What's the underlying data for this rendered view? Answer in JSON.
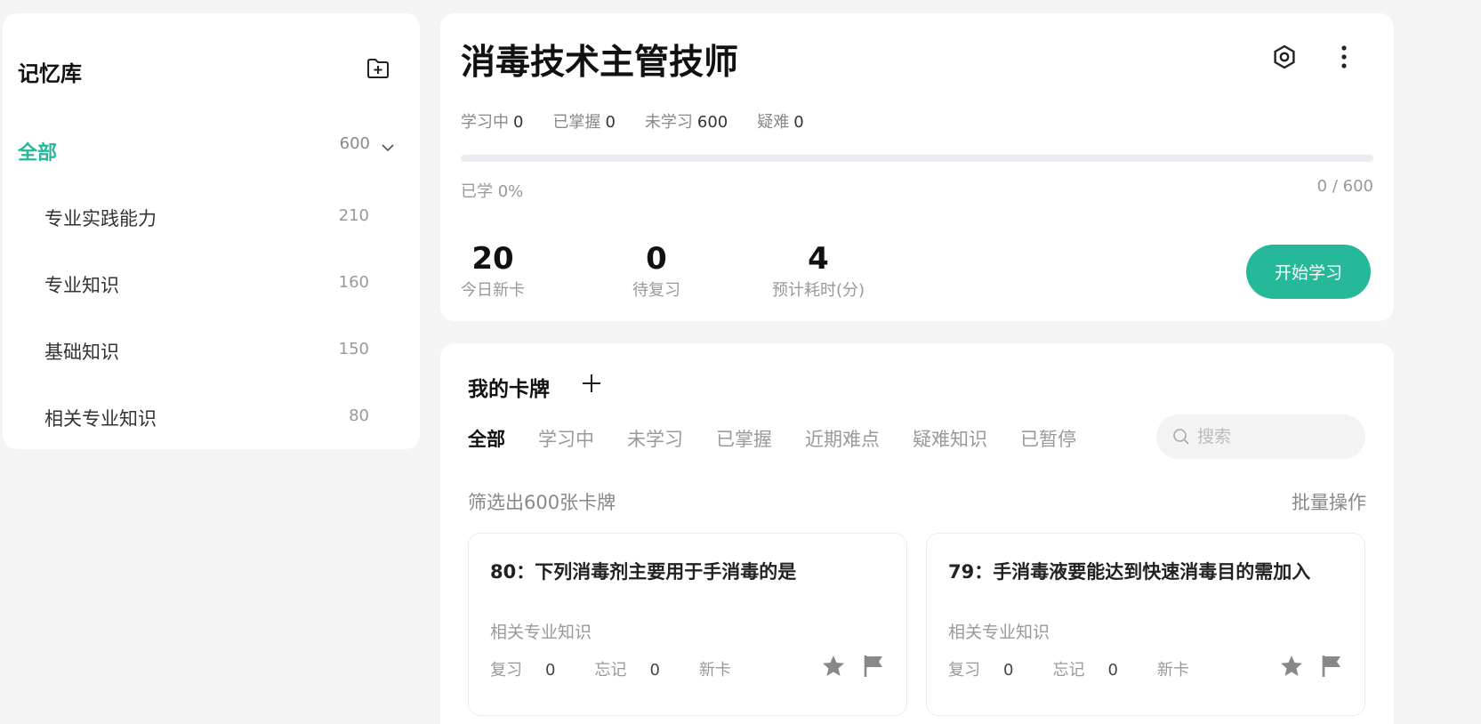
{
  "sidebar": {
    "title": "记忆库",
    "all": {
      "label": "全部",
      "count": "600"
    },
    "items": [
      {
        "label": "专业实践能力",
        "count": "210"
      },
      {
        "label": "专业知识",
        "count": "160"
      },
      {
        "label": "基础知识",
        "count": "150"
      },
      {
        "label": "相关专业知识",
        "count": "80"
      }
    ]
  },
  "deck": {
    "title": "消毒技术主管技师",
    "stats": [
      {
        "label": "学习中",
        "value": "0"
      },
      {
        "label": "已掌握",
        "value": "0"
      },
      {
        "label": "未学习",
        "value": "600"
      },
      {
        "label": "疑难",
        "value": "0"
      }
    ],
    "progress_label": "已学 0%",
    "progress_count": "0 / 600",
    "progress_fraction": 0,
    "metrics": [
      {
        "value": "20",
        "label": "今日新卡"
      },
      {
        "value": "0",
        "label": "待复习"
      },
      {
        "value": "4",
        "label": "预计耗时(分)"
      }
    ],
    "start_label": "开始学习"
  },
  "cards": {
    "title": "我的卡牌",
    "tabs": [
      "全部",
      "学习中",
      "未学习",
      "已掌握",
      "近期难点",
      "疑难知识",
      "已暂停"
    ],
    "active_tab": "全部",
    "search_placeholder": "搜索",
    "filter_count": "筛选出600张卡牌",
    "batch_label": "批量操作",
    "items": [
      {
        "question": "80：下列消毒剂主要用于手消毒的是",
        "category": "相关专业知识",
        "review_label": "复习",
        "review": "0",
        "forget_label": "忘记",
        "forget": "0",
        "status": "新卡"
      },
      {
        "question": "79：手消毒液要能达到快速消毒目的需加入",
        "category": "相关专业知识",
        "review_label": "复习",
        "review": "0",
        "forget_label": "忘记",
        "forget": "0",
        "status": "新卡"
      }
    ]
  },
  "colors": {
    "accent": "#25b99a",
    "icon": "#888888"
  }
}
